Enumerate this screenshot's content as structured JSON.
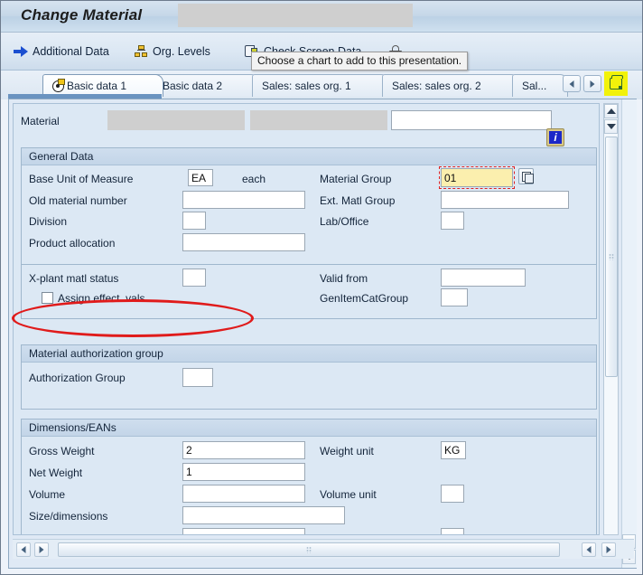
{
  "window": {
    "title": "Change Material",
    "title_redacted": true
  },
  "toolbar": {
    "items": [
      {
        "label": "Additional Data",
        "icon": "arrow-right-icon"
      },
      {
        "label": "Org. Levels",
        "icon": "org-levels-icon"
      },
      {
        "label": "Check Screen Data",
        "icon": "check-screen-data-icon"
      },
      {
        "label": "",
        "icon": "lock-icon"
      }
    ]
  },
  "tooltip": {
    "text": "Choose a chart to add to this presentation."
  },
  "tabs": {
    "items": [
      {
        "label": "Basic data 1",
        "active": true
      },
      {
        "label": "Basic data 2",
        "active": false
      },
      {
        "label": "Sales: sales org. 1",
        "active": false
      },
      {
        "label": "Sales: sales org. 2",
        "active": false
      },
      {
        "label": "Sal...",
        "active": false
      }
    ],
    "nav": {
      "prev_icon": "chevron-left-icon",
      "next_icon": "chevron-right-icon",
      "list_icon": "tab-list-icon",
      "list_highlight_color": "#f2f20a"
    }
  },
  "form": {
    "material": {
      "label": "Material",
      "value": "",
      "placeholder": ""
    },
    "info_icon": "info-icon",
    "sections": [
      {
        "title": "General Data",
        "fields": [
          {
            "label": "Base Unit of Measure",
            "value": "EA"
          },
          {
            "label": "",
            "value": "each"
          },
          {
            "label": "Material Group",
            "value": "01",
            "focused": true,
            "has_matchcode": true
          },
          {
            "label": "Old material number",
            "value": ""
          },
          {
            "label": "Ext. Matl Group",
            "value": ""
          },
          {
            "label": "Division",
            "value": ""
          },
          {
            "label": "Lab/Office",
            "value": ""
          },
          {
            "label": "Product allocation",
            "value": ""
          },
          {
            "label": "X-plant matl status",
            "value": ""
          },
          {
            "label": "Valid from",
            "value": ""
          },
          {
            "label": "Assign effect. vals",
            "value": "",
            "checkbox": true,
            "checked": false
          },
          {
            "label": "GenItemCatGroup",
            "value": ""
          }
        ]
      },
      {
        "title": "Material authorization group",
        "fields": [
          {
            "label": "Authorization Group",
            "value": ""
          }
        ]
      },
      {
        "title": "Dimensions/EANs",
        "fields": [
          {
            "label": "Gross Weight",
            "value": "2"
          },
          {
            "label": "Weight unit",
            "value": "KG"
          },
          {
            "label": "Net Weight",
            "value": "1"
          },
          {
            "label": "Volume",
            "value": ""
          },
          {
            "label": "Volume unit",
            "value": ""
          },
          {
            "label": "Size/dimensions",
            "value": ""
          }
        ]
      }
    ]
  },
  "annotation": {
    "shape": "ellipse",
    "color": "#e01b1b",
    "targets": "Assign effect. vals"
  },
  "scrollbars": {
    "vertical": {
      "up_icon": "scroll-up-icon",
      "down_icon": "scroll-down-icon"
    },
    "horizontal": {
      "left_icon": "scroll-left-icon",
      "right_icon": "scroll-right-icon"
    }
  }
}
